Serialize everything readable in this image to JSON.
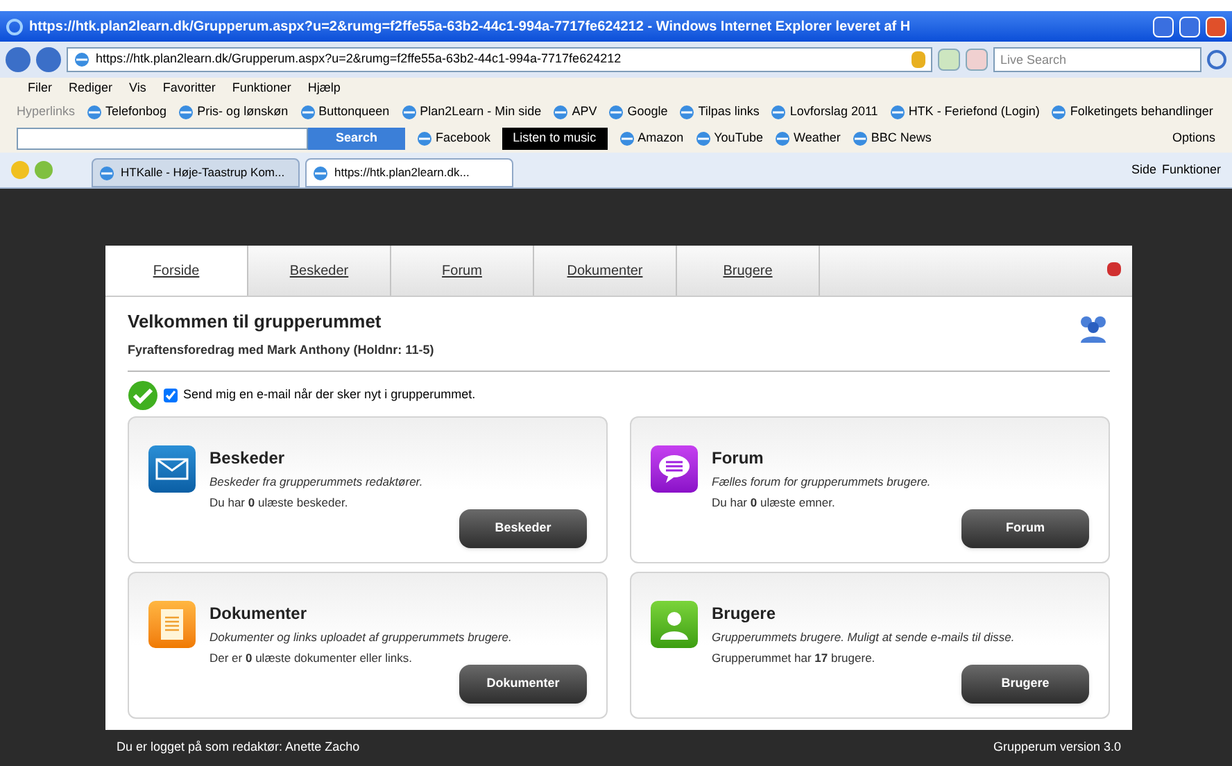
{
  "window": {
    "title": "https://htk.plan2learn.dk/Grupperum.aspx?u=2&rumg=f2ffe55a-63b2-44c1-994a-7717fe624212 - Windows Internet Explorer leveret af H"
  },
  "address": {
    "url": "https://htk.plan2learn.dk/Grupperum.aspx?u=2&rumg=f2ffe55a-63b2-44c1-994a-7717fe624212",
    "search_placeholder": "Live Search"
  },
  "menu": [
    "Filer",
    "Rediger",
    "Vis",
    "Favoritter",
    "Funktioner",
    "Hjælp"
  ],
  "links_bar": {
    "label": "Hyperlinks",
    "items": [
      "Telefonbog",
      "Pris- og lønskøn",
      "Buttonqueen",
      "Plan2Learn - Min side",
      "APV",
      "Google",
      "Tilpas links",
      "Lovforslag 2011",
      "HTK - Feriefond (Login)",
      "Folketingets behandlinger"
    ]
  },
  "search_bar": {
    "search_button": "Search",
    "items": [
      "Facebook",
      "Listen to music",
      "Amazon",
      "YouTube",
      "Weather",
      "BBC News"
    ],
    "options": "Options"
  },
  "browser_tabs": [
    {
      "label": "HTKalle - Høje-Taastrup Kom...",
      "selected": false
    },
    {
      "label": "https://htk.plan2learn.dk...",
      "selected": true
    }
  ],
  "command_bar": [
    "Side",
    "Funktioner"
  ],
  "page": {
    "nav_tabs": [
      {
        "label": "Forside",
        "selected": true
      },
      {
        "label": "Beskeder",
        "selected": false
      },
      {
        "label": "Forum",
        "selected": false
      },
      {
        "label": "Dokumenter",
        "selected": false
      },
      {
        "label": "Brugere",
        "selected": false
      }
    ],
    "heading": "Velkommen til grupperummet",
    "subheading": "Fyraftensforedrag med Mark Anthony (Holdnr: 11-5)",
    "email_option": {
      "checked": true,
      "label": "Send mig en e-mail når der sker nyt i grupperummet."
    },
    "cards": [
      {
        "kind": "messages",
        "title": "Beskeder",
        "description": "Beskeder fra grupperummets redaktører.",
        "status": "Du har **0** ulæste beskeder.",
        "button": "Beskeder"
      },
      {
        "kind": "forum",
        "title": "Forum",
        "description": "Fælles forum for grupperummets brugere.",
        "status": "Du har **0** ulæste emner.",
        "button": "Forum"
      },
      {
        "kind": "documents",
        "title": "Dokumenter",
        "description": "Dokumenter og links uploadet af grupperummets brugere.",
        "status": "Der er **0** ulæste dokumenter eller links.",
        "button": "Dokumenter"
      },
      {
        "kind": "users",
        "title": "Brugere",
        "description": "Grupperummets brugere. Muligt at sende e-mails til disse.",
        "status": "Grupperummet har **17** brugere.",
        "button": "Brugere"
      }
    ],
    "footer": {
      "left": "Du er logget på som redaktør: Anette Zacho",
      "right": "Grupperum version 3.0"
    }
  }
}
